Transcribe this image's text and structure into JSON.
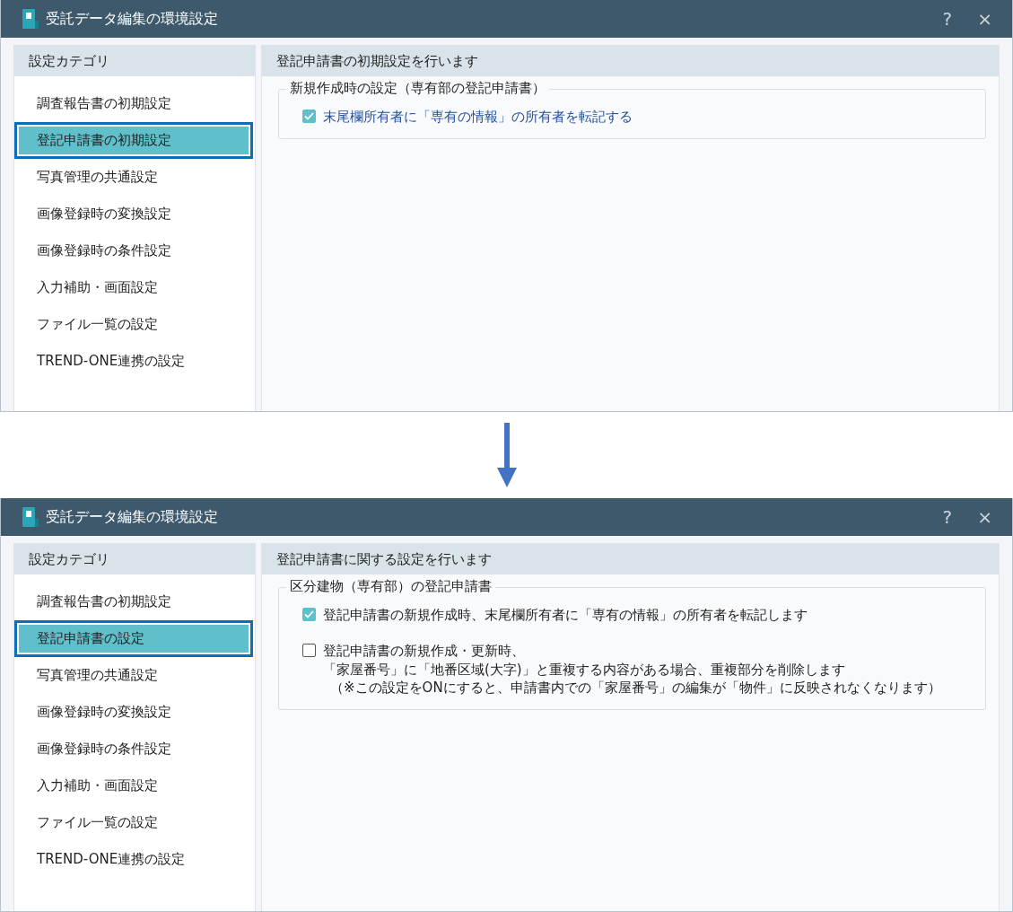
{
  "dialogs": [
    {
      "title": "受託データ編集の環境設定",
      "help": "?",
      "close": "×",
      "sidebar": {
        "header": "設定カテゴリ",
        "items": [
          {
            "label": "調査報告書の初期設定",
            "selected": false,
            "outlined": false
          },
          {
            "label": "登記申請書の初期設定",
            "selected": true,
            "outlined": true
          },
          {
            "label": "写真管理の共通設定",
            "selected": false,
            "outlined": false
          },
          {
            "label": "画像登録時の変換設定",
            "selected": false,
            "outlined": false
          },
          {
            "label": "画像登録時の条件設定",
            "selected": false,
            "outlined": false
          },
          {
            "label": "入力補助・画面設定",
            "selected": false,
            "outlined": false
          },
          {
            "label": "ファイル一覧の設定",
            "selected": false,
            "outlined": false
          },
          {
            "label": "TREND-ONE連携の設定",
            "selected": false,
            "outlined": false
          }
        ]
      },
      "content": {
        "header": "登記申請書の初期設定を行います",
        "group": {
          "legend": "新規作成時の設定（専有部の登記申請書）",
          "options": [
            {
              "text": "末尾欄所有者に「専有の情報」の所有者を転記する",
              "checked": true,
              "highlighted": true
            }
          ]
        }
      }
    },
    {
      "title": "受託データ編集の環境設定",
      "help": "?",
      "close": "×",
      "sidebar": {
        "header": "設定カテゴリ",
        "items": [
          {
            "label": "調査報告書の初期設定",
            "selected": false,
            "outlined": false
          },
          {
            "label": "登記申請書の設定",
            "selected": true,
            "outlined": true
          },
          {
            "label": "写真管理の共通設定",
            "selected": false,
            "outlined": false
          },
          {
            "label": "画像登録時の変換設定",
            "selected": false,
            "outlined": false
          },
          {
            "label": "画像登録時の条件設定",
            "selected": false,
            "outlined": false
          },
          {
            "label": "入力補助・画面設定",
            "selected": false,
            "outlined": false
          },
          {
            "label": "ファイル一覧の設定",
            "selected": false,
            "outlined": false
          },
          {
            "label": "TREND-ONE連携の設定",
            "selected": false,
            "outlined": false
          }
        ]
      },
      "content": {
        "header": "登記申請書に関する設定を行います",
        "group": {
          "legend": "区分建物（専有部）の登記申請書",
          "options": [
            {
              "text": "登記申請書の新規作成時、末尾欄所有者に「専有の情報」の所有者を転記します",
              "checked": true,
              "highlighted": false
            },
            {
              "text": "登記申請書の新規作成・更新時、",
              "text_2": "「家屋番号」に「地番区域(大字)」と重複する内容がある場合、重複部分を削除します",
              "note": "（※この設定をONにすると、申請書内での「家屋番号」の編集が「物件」に反映されなくなります）",
              "checked": false,
              "highlighted": false
            }
          ]
        }
      }
    }
  ]
}
